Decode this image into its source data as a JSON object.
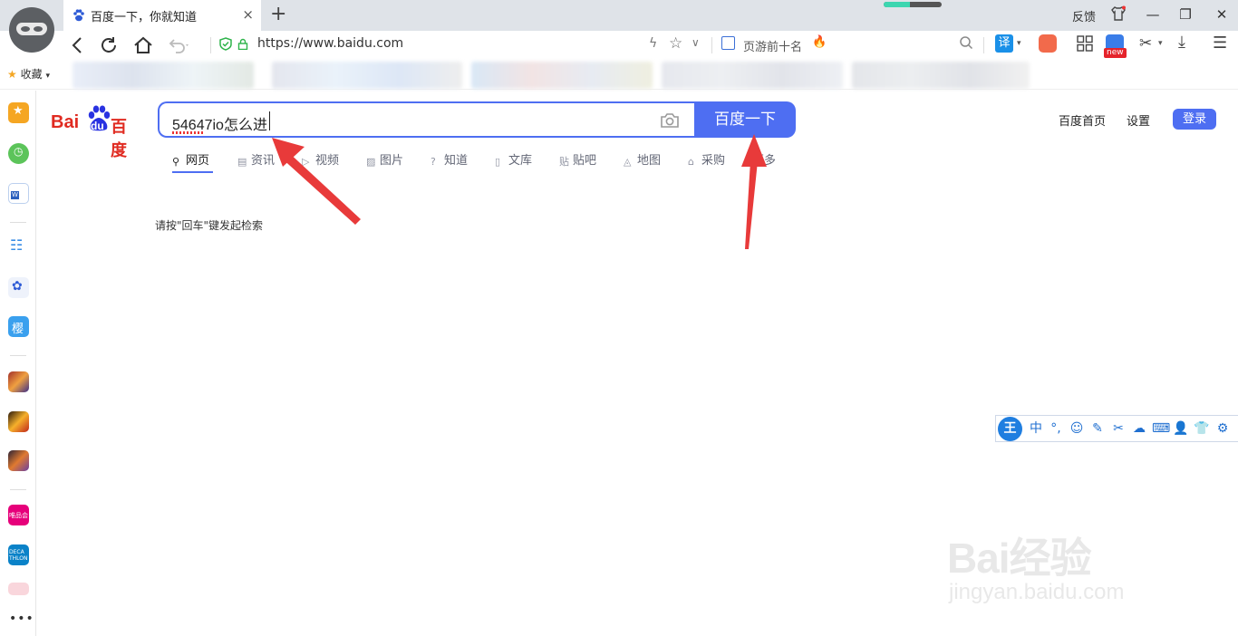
{
  "browser": {
    "tab_title": "百度一下，你就知道",
    "tab_close": "×",
    "new_tab": "+",
    "feedback": "反馈",
    "window_controls": {
      "minimize": "—",
      "restore": "❐",
      "close": "✕"
    },
    "progress_fraction": 0.45,
    "url": "https://www.baidu.com",
    "hot_search": "页游前十名",
    "translate_label": "译",
    "new_badge": "new",
    "bookmarks_label": "收藏"
  },
  "baidu": {
    "logo_bai": "Bai",
    "logo_du": "du",
    "logo_cn": "百度",
    "query": "54647io怎么进",
    "search_button": "百度一下",
    "top_links": [
      "百度首页",
      "设置"
    ],
    "login": "登录",
    "tabs": [
      "网页",
      "资讯",
      "视频",
      "图片",
      "知道",
      "文库",
      "贴吧",
      "地图",
      "采购",
      "更多"
    ],
    "hint": "请按\"回车\"键发起检索"
  },
  "ime": {
    "logo": "王",
    "mode": "中"
  },
  "watermark": {
    "brand": "Bai经验",
    "site": "jingyan.baidu.com"
  },
  "colors": {
    "baidu_blue": "#4e6ef2",
    "baidu_red": "#e02b21",
    "arrow_red": "#e83a3a"
  }
}
